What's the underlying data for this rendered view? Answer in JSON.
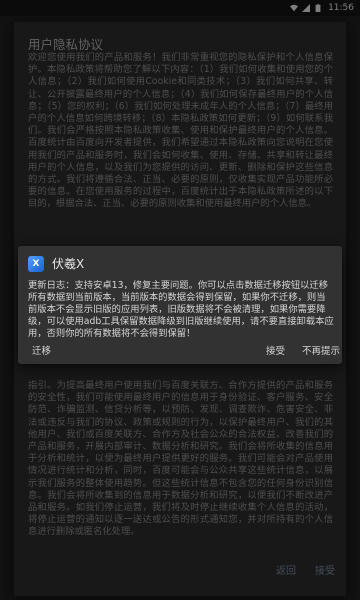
{
  "status_bar": {
    "time": "11:56"
  },
  "background_dialog": {
    "title": "用户隐私协议",
    "body": "欢迎您使用我们的产品和服务！我们非常重视您的隐私保护和个人信息保护。本隐私政策将帮助您了解以下内容：（1）我们如何收集和使用您的个人信息；（2）我们如何使用Cookie和同类技术；（3）我们如何共享、转让、公开披露最终用户的个人信息；（4）我们如何保存最终用户的个人信息；（5）您的权利；（6）我们如何处理未成年人的个人信息；（7）最终用户的个人信息如何跨境转移；（8）本隐私政策如何更新；（9）如何联系我们。我们会严格按照本隐私政策收集、使用和保护最终用户的个人信息。百度统计由百度向开发者提供，我们希望通过本隐私政策向您说明在您使用我们的产品和服务时，我们会如何收集、使用、存储、共享和转让最终用户的个人信息，以及我们为您提供的访问、更新、删除和保护这些信息的方式。我们将遵循合法、正当、必要的原则，仅收集实现产品功能所必要的信息。在您使用服务的过程中，百度统计出于本隐私政策所述的以下目的，根据合法、正当、必要的原则收集和使用最终用户的个人信息。",
    "bottom_text": "指引。为提高最终用户使用我们与百度关联方、合作方提供的产品和服务的安全性，我们可能使用最终用户的信息用于身份验证、客户服务、安全防范、诈骗监测、信贷分析等，以预防、发现、调查欺诈、危害安全、非法或违反与我们的协议、政策或规则的行为，以保护最终用户、我们的其他用户、我们或百度关联方、合作方及社会公众的合法权益。改善我们的产品和服务，开展内部审计、数据分析和研究。我们会将所收集的信息用于分析和统计，以便为最终用户提供更好的服务。我们可能会对产品使用情况进行统计和分析，同时，百度可能会与公众共享这些统计信息，以展示我们服务的整体使用趋势。但这些统计信息不包含您的任何身份识别信息。我们会将所收集到的信息用于数据分析和研究，以便我们不断改进产品和服务。如我们停止运营，我们将及时停止继续收集个人信息的活动，将停止运营的通知以逐一送达或公告的形式通知您，并对所持有的个人信息进行删除或匿名化处理。",
    "actions": {
      "back": "返回",
      "accept": "接受"
    }
  },
  "dialog": {
    "app_name": "伏羲X",
    "app_icon_glyph": "X",
    "message": "更新日志：支持安卓13，修复主要问题。你可以点击数据迁移按钮以迁移所有数据到当前版本，当前版本的数据会得到保留，如果你不迁移，则当前版本不会显示旧版的应用列表，旧版数据将不会被清理，如果你需要降级，可以使用adb工具保留数据降级到旧版继续使用，请不要直接卸载本应用，否则你的所有数据将不会得到保留！",
    "buttons": {
      "migrate": "迁移",
      "accept": "接受",
      "no_remind": "不再提示"
    }
  }
}
